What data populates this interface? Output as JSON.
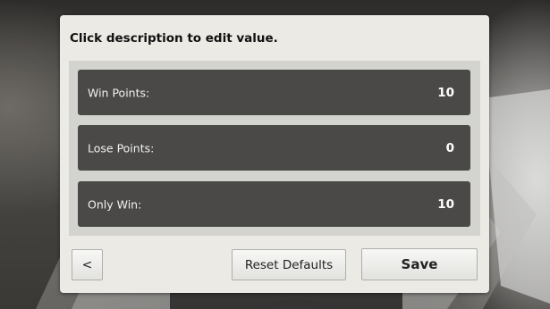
{
  "dialog": {
    "instruction": "Click description to edit value."
  },
  "settings": [
    {
      "label": "Win Points:",
      "value": "10"
    },
    {
      "label": "Lose Points:",
      "value": "0"
    },
    {
      "label": "Only Win:",
      "value": "10"
    }
  ],
  "buttons": {
    "back_label": "<",
    "reset_label": "Reset Defaults",
    "save_label": "Save"
  }
}
